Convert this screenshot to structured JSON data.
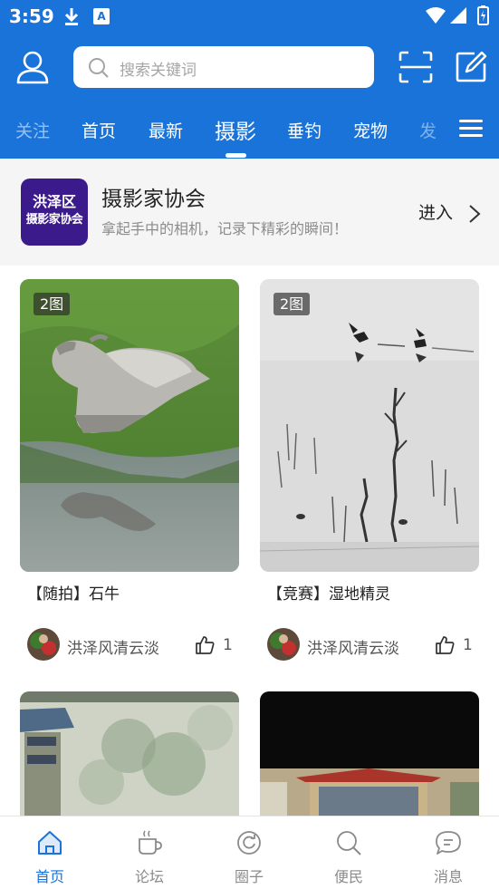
{
  "status_bar": {
    "time": "3:59",
    "notif_label": "A"
  },
  "search": {
    "placeholder": "搜索关键词"
  },
  "tabs": [
    {
      "label": "关注"
    },
    {
      "label": "首页"
    },
    {
      "label": "最新"
    },
    {
      "label": "摄影",
      "active": true
    },
    {
      "label": "垂钓"
    },
    {
      "label": "宠物"
    },
    {
      "label": "发"
    }
  ],
  "community": {
    "logo_line1": "洪泽区",
    "logo_line2": "摄影家协会",
    "name": "摄影家协会",
    "description": "拿起手中的相机，记录下精彩的瞬间！",
    "enter_label": "进入"
  },
  "posts": [
    {
      "badge": "2图",
      "title": "【随拍】石牛",
      "author": "洪泽风清云淡",
      "likes": "1"
    },
    {
      "badge": "2图",
      "title": "【竞赛】湿地精灵",
      "author": "洪泽风清云淡",
      "likes": "1"
    }
  ],
  "bottom_nav": [
    {
      "label": "首页",
      "icon": "home-icon",
      "active": true
    },
    {
      "label": "论坛",
      "icon": "coffee-cup-icon"
    },
    {
      "label": "圈子",
      "icon": "circle-refresh-icon"
    },
    {
      "label": "便民",
      "icon": "search-icon"
    },
    {
      "label": "消息",
      "icon": "message-bubble-icon"
    }
  ],
  "colors": {
    "brand_blue": "#1a73d9",
    "logo_purple": "#3b1a8c",
    "community_bg": "#f5f5f5"
  }
}
